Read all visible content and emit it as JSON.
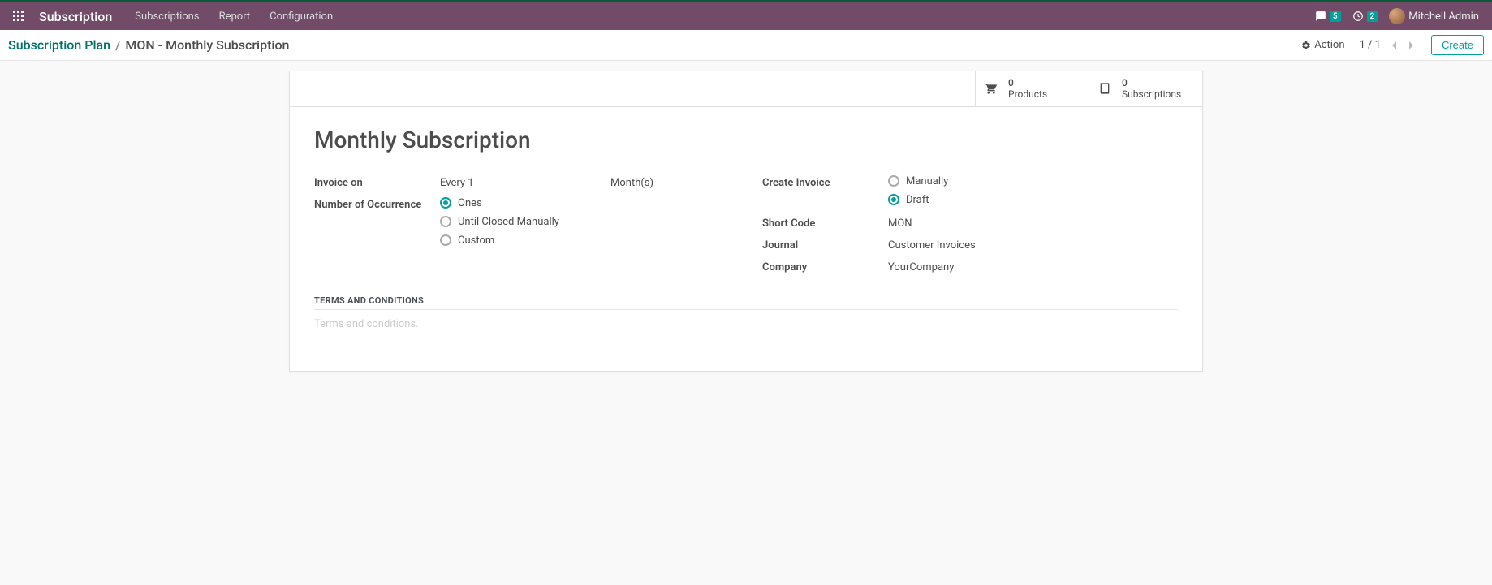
{
  "nav": {
    "brand": "Subscription",
    "menu": [
      "Subscriptions",
      "Report",
      "Configuration"
    ],
    "chat_count": "5",
    "activity_count": "2",
    "user": "Mitchell Admin"
  },
  "breadcrumb": {
    "root": "Subscription Plan",
    "sep": "/",
    "current": "MON - Monthly Subscription"
  },
  "actions": {
    "action_label": "Action",
    "pager": "1 / 1",
    "create_label": "Create"
  },
  "stats": {
    "products_count": "0",
    "products_label": "Products",
    "subs_count": "0",
    "subs_label": "Subscriptions"
  },
  "form": {
    "title": "Monthly Subscription",
    "labels": {
      "invoice_on": "Invoice on",
      "number_occurrence": "Number of Occurrence",
      "create_invoice": "Create Invoice",
      "short_code": "Short Code",
      "journal": "Journal",
      "company": "Company"
    },
    "values": {
      "invoice_on_every": "Every 1",
      "invoice_on_unit": "Month(s)",
      "short_code": "MON",
      "journal": "Customer Invoices",
      "company": "YourCompany"
    },
    "occurrence_options": {
      "ones": "Ones",
      "until_closed": "Until Closed Manually",
      "custom": "Custom"
    },
    "create_invoice_options": {
      "manually": "Manually",
      "draft": "Draft"
    },
    "terms_header": "TERMS AND CONDITIONS",
    "terms_placeholder": "Terms and conditions."
  }
}
